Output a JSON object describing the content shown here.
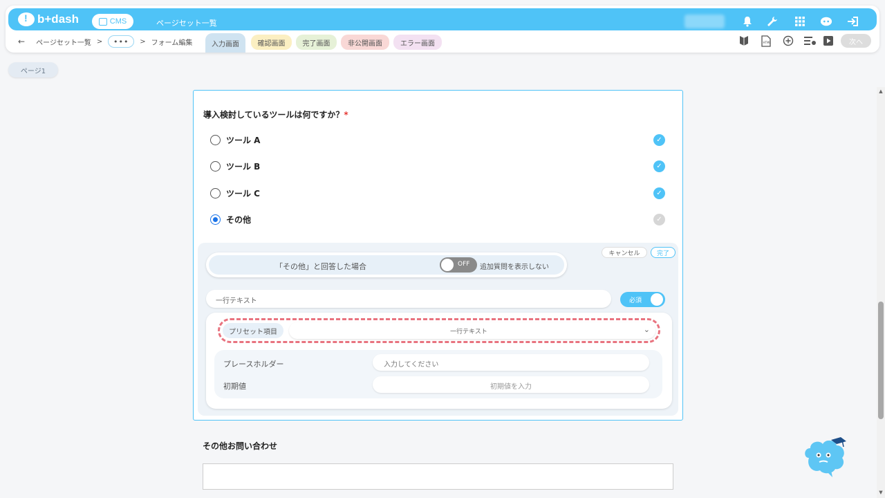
{
  "app": {
    "logo_text": "b+dash",
    "cms_label": "CMS",
    "title": "ページセット一覧"
  },
  "breadcrumb": {
    "back_icon": "arrow-left-icon",
    "first": "ページセット一覧",
    "sep": ">",
    "dots": "•••",
    "current": "フォーム編集"
  },
  "tabs": [
    {
      "label": "入力画面",
      "color": "#cfe3f1"
    },
    {
      "label": "確認画面",
      "color": "#fbefc2"
    },
    {
      "label": "完了画面",
      "color": "#e6f1d7"
    },
    {
      "label": "非公開画面",
      "color": "#f9d8d6"
    },
    {
      "label": "エラー画面",
      "color": "#f3e1f2"
    }
  ],
  "toolbar": {
    "next_label": "次へ"
  },
  "page_pill": "ページ1",
  "question": {
    "title": "導入検討しているツールは何ですか？",
    "required_mark": "*",
    "options": [
      {
        "label": "ツール A",
        "selected": false,
        "checked": true
      },
      {
        "label": "ツール B",
        "selected": false,
        "checked": true
      },
      {
        "label": "ツール C",
        "selected": false,
        "checked": true
      },
      {
        "label": "その他",
        "selected": true,
        "checked": false
      }
    ]
  },
  "conditional": {
    "condition_text": "「その他」と回答した場合",
    "toggle_state": "OFF",
    "toggle_label": "追加質問を表示しない",
    "cancel_label": "キャンセル",
    "done_label": "完了"
  },
  "additional_field": {
    "type_text": "一行テキスト",
    "required_label": "必須",
    "preset_label": "プリセット項目",
    "preset_value": "一行テキスト",
    "placeholder_label": "プレースホルダー",
    "placeholder_value": "入力してください",
    "default_label": "初期値",
    "default_placeholder": "初期値を入力"
  },
  "question2": {
    "title": "その他お問い合わせ"
  },
  "colors": {
    "accent": "#4fc3f7",
    "danger": "#e8737f"
  }
}
